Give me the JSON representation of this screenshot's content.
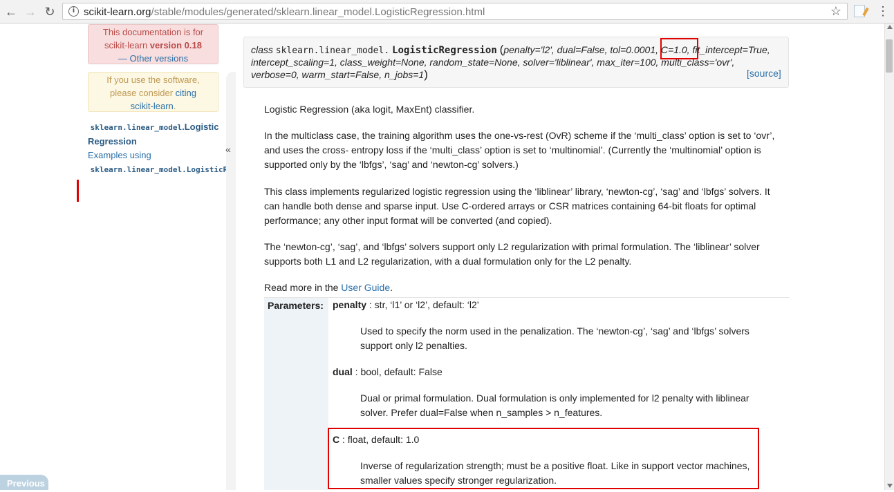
{
  "browser": {
    "url_host": "scikit-learn.org",
    "url_path": "/stable/modules/generated/sklearn.linear_model.LogisticRegression.html"
  },
  "sidebar": {
    "version_line1": "This documentation is for",
    "version_line2_pre": "scikit-learn ",
    "version_line2_bold": "version 0.18",
    "version_line3": "— Other versions",
    "cite_line1": "If you use the software,",
    "cite_line2_pre": "please consider ",
    "cite_link": "citing",
    "cite_line3_link": "scikit-learn",
    "cite_line3_post": ".",
    "toc_item1_mono": "sklearn.linear_model",
    "toc_item1_rest1": ".Logistic",
    "toc_item1_rest2": "Regression",
    "toc_item2": "Examples using",
    "toc_item3_mono": "sklearn.linear_model.LogisticR",
    "collapse": "«",
    "previous": "Previous"
  },
  "signature": {
    "keyword": "class",
    "module": "sklearn.linear_model.",
    "name": "LogisticRegression",
    "open_paren": "(",
    "args_line1_a": "penalty='l2', dual=False, tol=0.0001, ",
    "args_line1_c": "C=1.0",
    "args_line1_b": ", fit_intercept=True,",
    "args_line2": "intercept_scaling=1, class_weight=None, random_state=None, solver='liblinear', max_iter=100, multi_class='ovr',",
    "args_line3": "verbose=0, warm_start=False, n_jobs=1",
    "close_paren": ")",
    "source": "[source]"
  },
  "doc": {
    "p1": "Logistic Regression (aka logit, MaxEnt) classifier.",
    "p2": "In the multiclass case, the training algorithm uses the one-vs-rest (OvR) scheme if the ‘multi_class’ option is set to ‘ovr’, and uses the cross- entropy loss if the ‘multi_class’ option is set to ‘multinomial’. (Currently the ‘multinomial’ option is supported only by the ‘lbfgs’, ‘sag’ and ‘newton-cg’ solvers.)",
    "p3": "This class implements regularized logistic regression using the ‘liblinear’ library, ‘newton-cg’, ‘sag’ and ‘lbfgs’ solvers. It can handle both dense and sparse input. Use C-ordered arrays or CSR matrices containing 64-bit floats for optimal performance; any other input format will be converted (and copied).",
    "p4": "The ‘newton-cg’, ‘sag’, and ‘lbfgs’ solvers support only L2 regularization with primal formulation. The ‘liblinear’ solver supports both L1 and L2 regularization, with a dual formulation only for the L2 penalty.",
    "readmore_pre": "Read more in the ",
    "readmore_link": "User Guide",
    "readmore_post": "."
  },
  "params": {
    "label": "Parameters:",
    "items": [
      {
        "name": "penalty",
        "type": " : str, ‘l1’ or ‘l2’, default: ‘l2’",
        "desc": "Used to specify the norm used in the penalization. The ‘newton-cg’, ‘sag’ and ‘lbfgs’ solvers support only l2 penalties."
      },
      {
        "name": "dual",
        "type": " : bool, default: False",
        "desc": "Dual or primal formulation. Dual formulation is only implemented for l2 penalty with liblinear solver. Prefer dual=False when n_samples > n_features."
      },
      {
        "name": "C",
        "type": " : float, default: 1.0",
        "desc": "Inverse of regularization strength; must be a positive float. Like in support vector machines, smaller values specify stronger regularization."
      }
    ]
  }
}
